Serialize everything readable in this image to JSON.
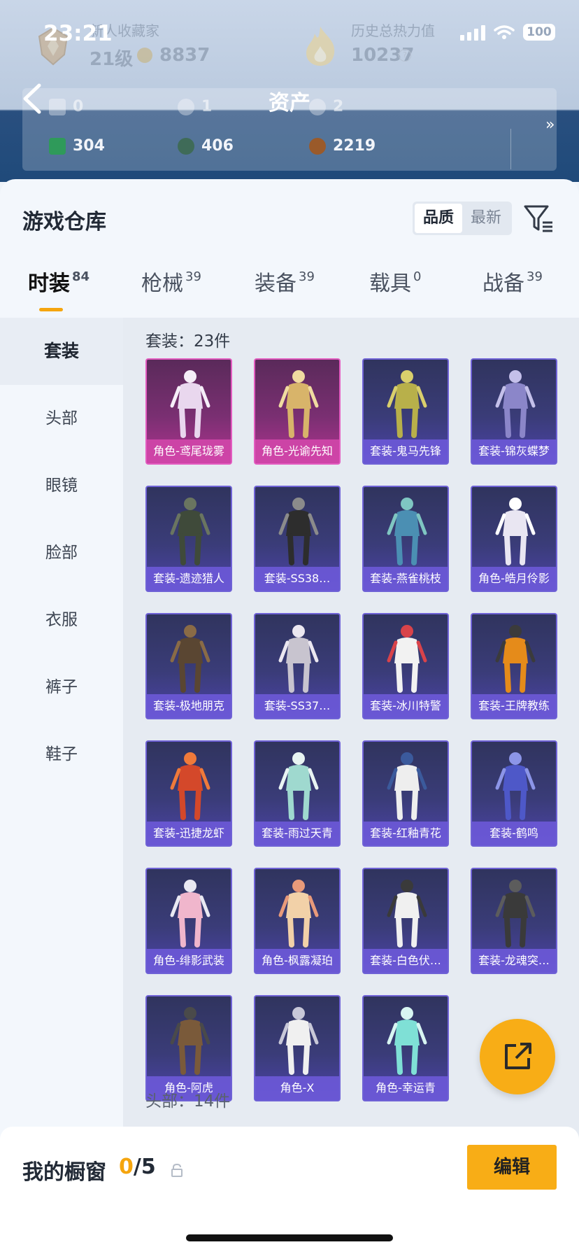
{
  "status_bar": {
    "time": "23:21",
    "battery": "100"
  },
  "profile": {
    "collector_title": "新人收藏家",
    "level": "21级",
    "coins": "8837",
    "heat_title": "历史总热力值",
    "heat_value": "10237",
    "heat_help": "?"
  },
  "nav": {
    "title": "资产"
  },
  "assets": {
    "row1": [
      "0",
      "1",
      "2"
    ],
    "row2": [
      "304",
      "406",
      "2219"
    ],
    "more": "»"
  },
  "warehouse": {
    "title": "游戏仓库",
    "sort_options": [
      "品质",
      "最新"
    ],
    "active_sort": "品质"
  },
  "tabs": [
    {
      "label": "时装",
      "count": "84"
    },
    {
      "label": "枪械",
      "count": "39"
    },
    {
      "label": "装备",
      "count": "39"
    },
    {
      "label": "载具",
      "count": "0"
    },
    {
      "label": "战备",
      "count": "39"
    }
  ],
  "side_menu": [
    "套装",
    "头部",
    "眼镜",
    "脸部",
    "衣服",
    "裤子",
    "鞋子"
  ],
  "section": {
    "label": "套装：23件",
    "next_label": "头部：14件"
  },
  "items": [
    {
      "label": "角色-鸢尾珑雾",
      "rarity": "pink"
    },
    {
      "label": "角色-光谕先知",
      "rarity": "pink"
    },
    {
      "label": "套装-鬼马先锋",
      "rarity": "purple"
    },
    {
      "label": "套装-锦灰蝶梦",
      "rarity": "purple"
    },
    {
      "label": "套装-遗迹猎人",
      "rarity": "purple"
    },
    {
      "label": "套装-SS38…",
      "rarity": "purple"
    },
    {
      "label": "套装-燕雀桃枝",
      "rarity": "purple"
    },
    {
      "label": "角色-皓月伶影",
      "rarity": "purple"
    },
    {
      "label": "套装-极地朋克",
      "rarity": "purple"
    },
    {
      "label": "套装-SS37…",
      "rarity": "purple"
    },
    {
      "label": "套装-冰川特警",
      "rarity": "purple"
    },
    {
      "label": "套装-王牌教练",
      "rarity": "purple"
    },
    {
      "label": "套装-迅捷龙虾",
      "rarity": "purple"
    },
    {
      "label": "套装-雨过天青",
      "rarity": "purple"
    },
    {
      "label": "套装-红釉青花",
      "rarity": "purple"
    },
    {
      "label": "套装-鹤鸣",
      "rarity": "purple"
    },
    {
      "label": "角色-绯影武装",
      "rarity": "purple"
    },
    {
      "label": "角色-枫露凝珀",
      "rarity": "purple"
    },
    {
      "label": "套装-白色伏…",
      "rarity": "purple"
    },
    {
      "label": "套装-龙魂突…",
      "rarity": "purple"
    },
    {
      "label": "角色-阿虎",
      "rarity": "purple"
    },
    {
      "label": "角色-X",
      "rarity": "purple"
    },
    {
      "label": "角色-幸运青",
      "rarity": "purple"
    }
  ],
  "showcase": {
    "title": "我的橱窗",
    "current": "0",
    "total": "/5",
    "edit_label": "编辑"
  },
  "colors": {
    "accent": "#f8ad16",
    "pink_rarity": "#e35cc0",
    "purple_rarity": "#6f62d6"
  }
}
